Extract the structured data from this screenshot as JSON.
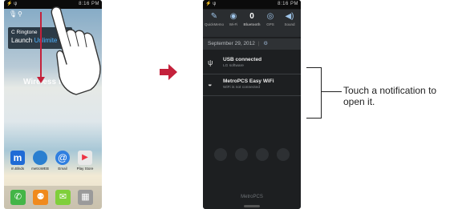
{
  "left_screen": {
    "status_time": "8:16 PM",
    "notification_hint_line1": "C Ringtone",
    "notification_hint_line2_prefix": "Launch",
    "notification_hint_line2_highlight": "Unlimite",
    "wallpaper_text": "Wireless for A",
    "apps": [
      {
        "label": "m.Blnds",
        "color": "#1f6bd6",
        "icon": "m"
      },
      {
        "label": "metroWEB",
        "color": "#2a7fd0",
        "icon": "🌐"
      },
      {
        "label": "Email",
        "color": "#2f7fe0",
        "icon": "@"
      },
      {
        "label": "Play Store",
        "color": "#e9e9e9",
        "icon": "▶"
      }
    ],
    "dock": [
      {
        "name": "phone-icon",
        "color": "#43b547",
        "glyph": "✆"
      },
      {
        "name": "contacts-icon",
        "color": "#f08a1d",
        "glyph": "👤"
      },
      {
        "name": "messaging-icon",
        "color": "#7fcf3a",
        "glyph": "✉"
      },
      {
        "name": "apps-icon",
        "color": "#9a9a9a",
        "glyph": "▦"
      }
    ]
  },
  "right_screen": {
    "status_time": "8:16 PM",
    "quick_settings": [
      {
        "label": "QuickMemo",
        "glyph": "✎"
      },
      {
        "label": "Wi-Fi",
        "glyph": "◉"
      },
      {
        "label": "Bluetooth",
        "glyph": "0"
      },
      {
        "label": "GPS",
        "glyph": "◎"
      },
      {
        "label": "Sound",
        "glyph": "◀)"
      }
    ],
    "date": "September 29, 2012",
    "notifications": [
      {
        "title": "USB connected",
        "subtitle": "LG software",
        "icon": "usb-icon",
        "glyph": "ψ"
      },
      {
        "title": "MetroPCS Easy WiFi",
        "subtitle": "WiFi is not connected",
        "icon": "wifi-icon",
        "glyph": "◒"
      }
    ],
    "bottom_carrier": "MetroPCS"
  },
  "callout": {
    "text": "Touch a notification to open it."
  },
  "colors": {
    "accent_arrow": "#c4213b",
    "shade_bg": "#1d1f21"
  }
}
